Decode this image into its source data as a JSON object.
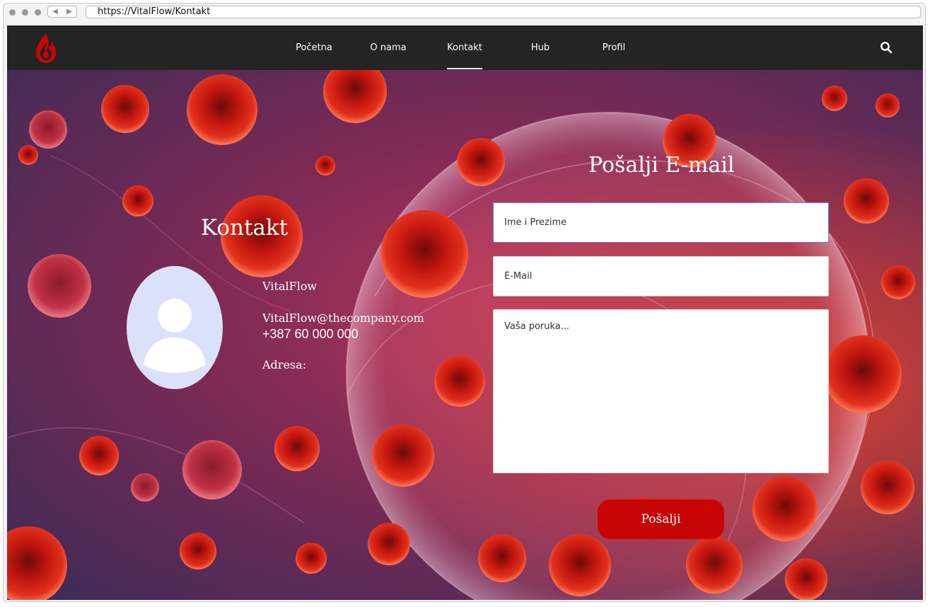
{
  "browser": {
    "url": "https://VitalFlow/Kontakt",
    "back_glyph": "◀",
    "forward_glyph": "▶"
  },
  "nav": {
    "items": [
      {
        "label": "Početna"
      },
      {
        "label": "O nama"
      },
      {
        "label": "Kontakt",
        "active": true
      },
      {
        "label": "Hub"
      },
      {
        "label": "Profil"
      }
    ],
    "logo_icon": "blood-drop-flame-icon",
    "search_icon": "search-icon"
  },
  "contact": {
    "heading": "Kontakt",
    "company": "VitalFlow",
    "email": "VitalFlow@thecompany.com",
    "phone": " +387 60 000 000",
    "address_label": "Adresa:"
  },
  "form": {
    "heading": "Pošalji E-mail",
    "name_placeholder": "Ime i Prezime",
    "email_placeholder": "E-Mail",
    "message_placeholder": "Vaša poruka...",
    "submit_label": "Pošalji"
  },
  "colors": {
    "nav_bg": "#242424",
    "accent": "#c80404",
    "avatar_bg": "#dbe1fb"
  }
}
